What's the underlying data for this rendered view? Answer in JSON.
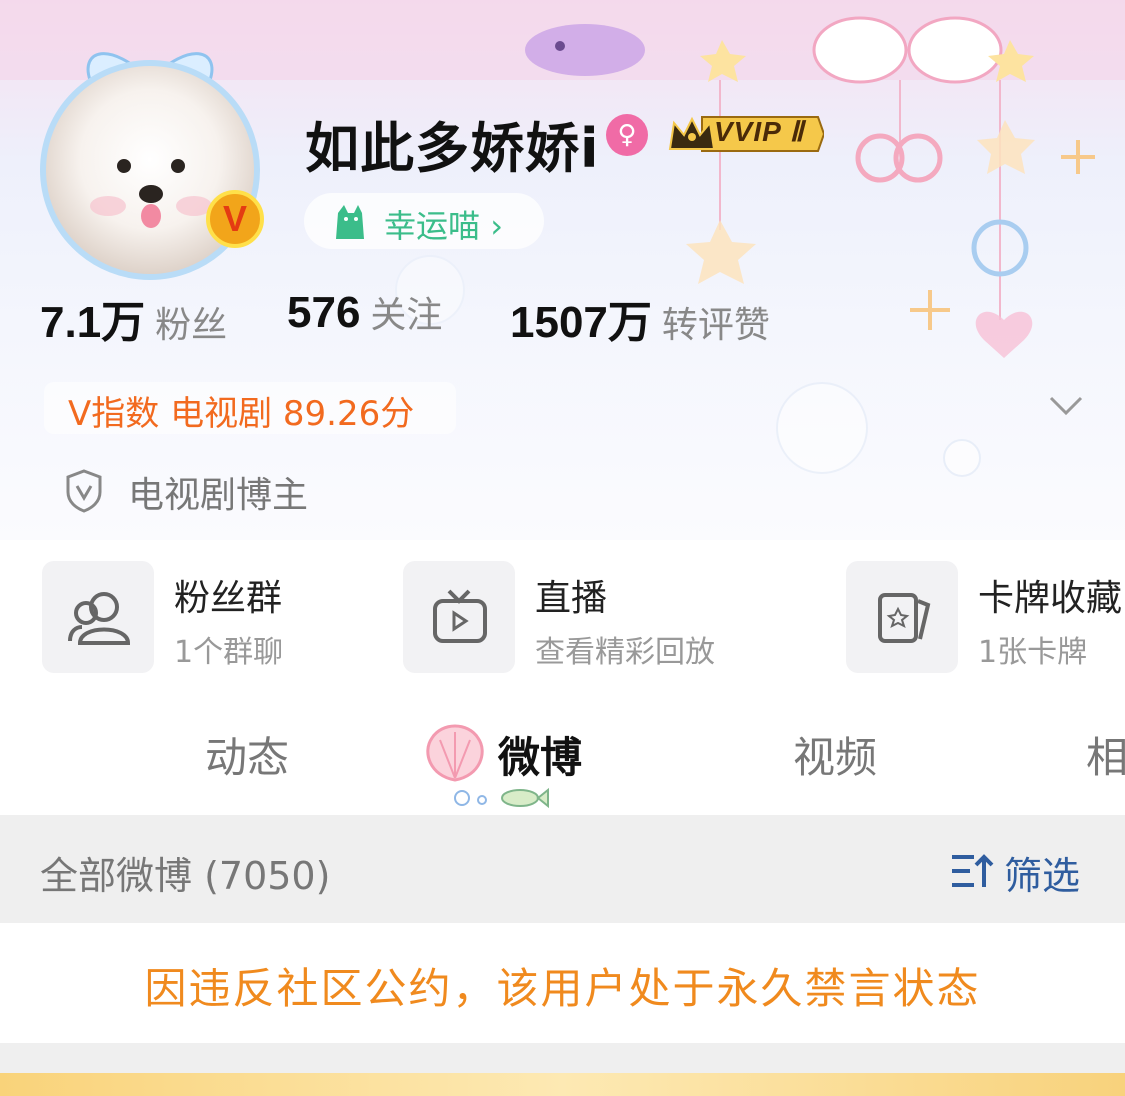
{
  "profile": {
    "username": "如此多娇娇i",
    "gender_icon": "female-icon",
    "vip_label": "VVIP Ⅱ",
    "lucky_label": "幸运喵",
    "lucky_chevron": "›"
  },
  "stats": [
    {
      "value": "7.1万",
      "label": "粉丝"
    },
    {
      "value": "576",
      "label": "关注"
    },
    {
      "value": "1507万",
      "label": "转评赞"
    }
  ],
  "vindex": {
    "text": "V指数 电视剧 89.26分"
  },
  "tag": {
    "label": "电视剧博主"
  },
  "features": [
    {
      "title": "粉丝群",
      "subtitle": "1个群聊",
      "icon": "fan-group-icon"
    },
    {
      "title": "直播",
      "subtitle": "查看精彩回放",
      "icon": "tv-icon"
    },
    {
      "title": "卡牌收藏",
      "subtitle": "1张卡牌",
      "icon": "card-icon"
    }
  ],
  "tabs": [
    {
      "label": "动态"
    },
    {
      "label": "微博",
      "active": true
    },
    {
      "label": "视频"
    },
    {
      "label": "相"
    }
  ],
  "filter": {
    "count_label": "全部微博 (7050)",
    "button_label": "筛选"
  },
  "notice": {
    "text": "因违反社区公约，该用户处于永久禁言状态"
  },
  "colors": {
    "accent_orange": "#f26a1f",
    "notice_orange": "#f08a1e",
    "link_blue": "#2f5d9f",
    "lucky_green": "#3bbd8a",
    "v_badge": "#f2a51a"
  }
}
